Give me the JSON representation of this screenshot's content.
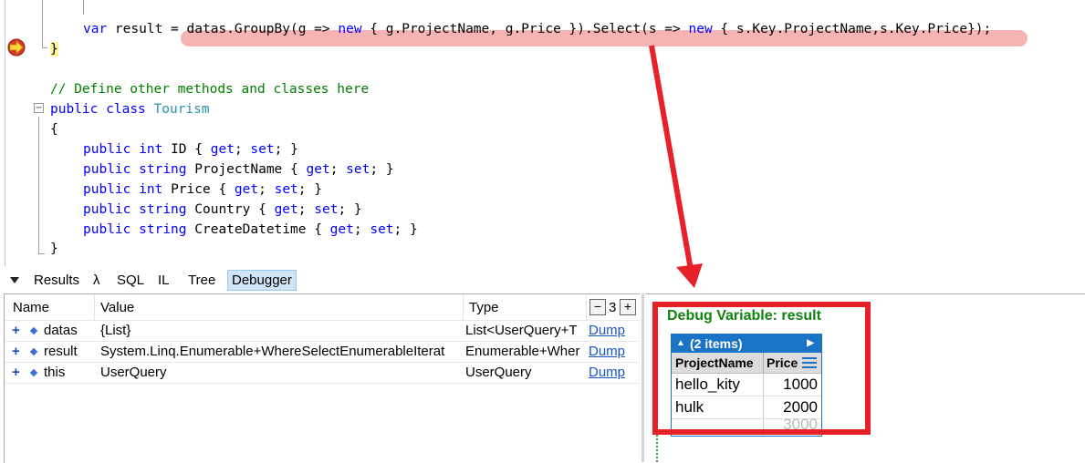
{
  "editor": {
    "var_line": {
      "kw": "var",
      "text": " result = datas.GroupBy(g => ",
      "new1": "new",
      "mid": " { g.ProjectName, g.Price }).Select(s => ",
      "new2": "new",
      "end": " { s.Key.ProjectName,s.Key.Price});"
    },
    "close_brace": "}",
    "comment": "// Define other methods and classes here",
    "class_decl": {
      "kw1": "public",
      "kw2": "class",
      "name": "Tourism"
    },
    "open_brace": "{",
    "properties": [
      {
        "access": "public",
        "type": "int",
        "name": "ID",
        "get": "get",
        "set": "set"
      },
      {
        "access": "public",
        "type": "string",
        "name": "ProjectName",
        "get": "get",
        "set": "set"
      },
      {
        "access": "public",
        "type": "int",
        "name": "Price",
        "get": "get",
        "set": "set"
      },
      {
        "access": "public",
        "type": "string",
        "name": "Country",
        "get": "get",
        "set": "set"
      },
      {
        "access": "public",
        "type": "string",
        "name": "CreateDatetime",
        "get": "get",
        "set": "set"
      }
    ],
    "end_brace": "}",
    "breakpoint_icon": "current-statement-arrow-icon"
  },
  "tabs": {
    "toggle_icon": "triangle-down-icon",
    "items": [
      "Results",
      "λ",
      "SQL",
      "IL",
      "Tree",
      "Debugger"
    ],
    "active": "Debugger"
  },
  "grid": {
    "columns": [
      "Name",
      "Value",
      "Type"
    ],
    "depth_minus": "−",
    "depth_value": "3",
    "depth_plus": "+",
    "rows": [
      {
        "expand": "+",
        "name": "datas",
        "value": "{List}",
        "type": "List<UserQuery+T",
        "action": "Dump"
      },
      {
        "expand": "+",
        "name": "result",
        "value": "System.Linq.Enumerable+WhereSelectEnumerableIterat",
        "type": "Enumerable+Wher",
        "action": "Dump"
      },
      {
        "expand": "+",
        "name": "this",
        "value": "UserQuery",
        "type": "UserQuery",
        "action": "Dump"
      }
    ]
  },
  "output": {
    "title": "Debug Variable: result",
    "header": "(2 items)",
    "collapse_icon": "triangle-up-icon",
    "next_icon": "triangle-right-icon",
    "col1": "ProjectName",
    "col2": "Price",
    "menu_icon": "hamburger-icon",
    "rows": [
      {
        "name": "hello_kity",
        "price": "1000"
      },
      {
        "name": "hulk",
        "price": "2000"
      }
    ],
    "total": "3000"
  },
  "colors": {
    "annotation": "#e8202a",
    "highlight": "#f08080",
    "accent": "#1a73c4"
  }
}
